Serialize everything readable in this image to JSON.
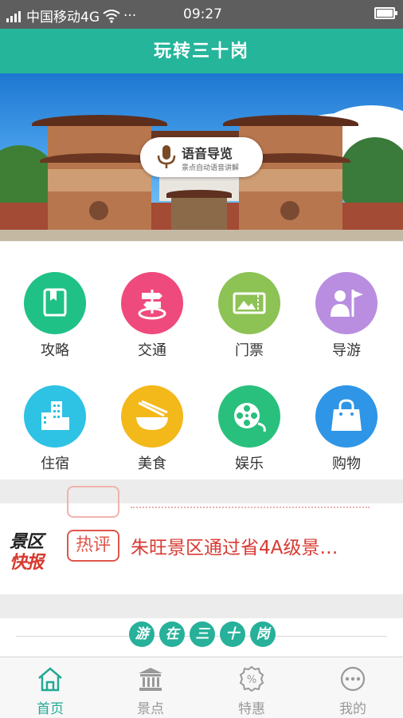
{
  "status_bar": {
    "carrier": "中国移动4G",
    "more": "···",
    "time": "09:27"
  },
  "app": {
    "title": "玩转三十岗"
  },
  "banner": {
    "audio_guide_title": "语音导览",
    "audio_guide_subtitle": "景点自动语音讲解"
  },
  "categories": [
    {
      "label": "攻略",
      "icon": "book-icon",
      "color": "#1fc187"
    },
    {
      "label": "交通",
      "icon": "signpost-icon",
      "color": "#ef4a7d"
    },
    {
      "label": "门票",
      "icon": "ticket-icon",
      "color": "#8dc254"
    },
    {
      "label": "导游",
      "icon": "guide-flag-icon",
      "color": "#b98ee0"
    },
    {
      "label": "住宿",
      "icon": "building-icon",
      "color": "#2ec2e4"
    },
    {
      "label": "美食",
      "icon": "bowl-icon",
      "color": "#f3b819"
    },
    {
      "label": "娱乐",
      "icon": "film-reel-icon",
      "color": "#29c07d"
    },
    {
      "label": "购物",
      "icon": "shopping-bag-icon",
      "color": "#2f95e6"
    }
  ],
  "news": {
    "logo_line1": "景区",
    "logo_line2": "快报",
    "tag": "热评",
    "headline": "朱旺景区通过省4A级景…"
  },
  "section": {
    "title_chars": [
      "游",
      "在",
      "三",
      "十",
      "岗"
    ]
  },
  "tabs": [
    {
      "label": "首页",
      "icon": "home-icon",
      "active": true
    },
    {
      "label": "景点",
      "icon": "temple-icon",
      "active": false
    },
    {
      "label": "特惠",
      "icon": "discount-icon",
      "active": false
    },
    {
      "label": "我的",
      "icon": "more-icon",
      "active": false
    }
  ],
  "colors": {
    "brand": "#25b59b",
    "active_tab": "#22a994",
    "headline": "#d83a33"
  }
}
